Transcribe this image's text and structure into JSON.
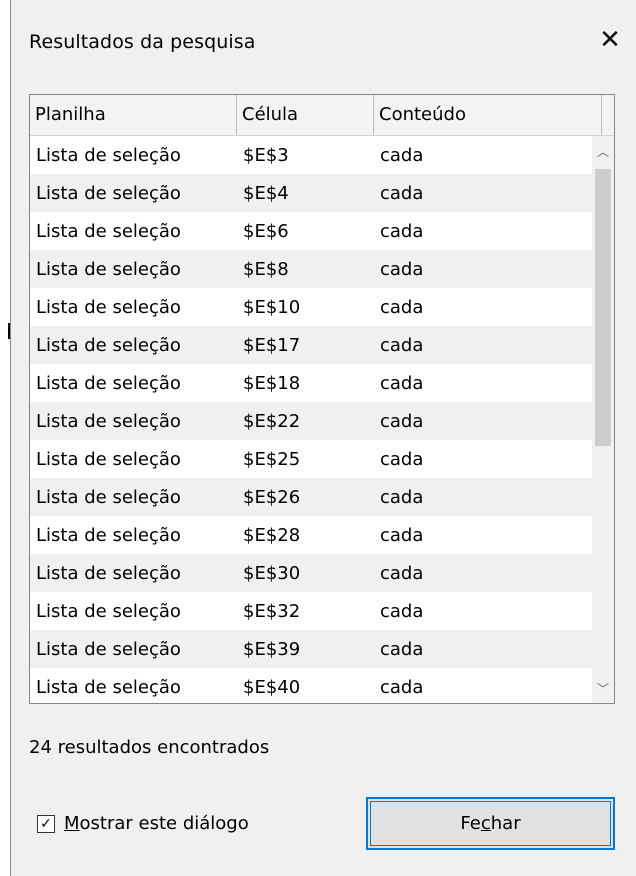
{
  "window": {
    "title": "Resultados da pesquisa",
    "close_glyph": "✕",
    "close_icon": "close-icon"
  },
  "table": {
    "columns": [
      "Planilha",
      "Célula",
      "Conteúdo"
    ],
    "rows": [
      [
        "Lista de seleção",
        "$E$3",
        "cada"
      ],
      [
        "Lista de seleção",
        "$E$4",
        "cada"
      ],
      [
        "Lista de seleção",
        "$E$6",
        "cada"
      ],
      [
        "Lista de seleção",
        "$E$8",
        "cada"
      ],
      [
        "Lista de seleção",
        "$E$10",
        "cada"
      ],
      [
        "Lista de seleção",
        "$E$17",
        "cada"
      ],
      [
        "Lista de seleção",
        "$E$18",
        "cada"
      ],
      [
        "Lista de seleção",
        "$E$22",
        "cada"
      ],
      [
        "Lista de seleção",
        "$E$25",
        "cada"
      ],
      [
        "Lista de seleção",
        "$E$26",
        "cada"
      ],
      [
        "Lista de seleção",
        "$E$28",
        "cada"
      ],
      [
        "Lista de seleção",
        "$E$30",
        "cada"
      ],
      [
        "Lista de seleção",
        "$E$32",
        "cada"
      ],
      [
        "Lista de seleção",
        "$E$39",
        "cada"
      ],
      [
        "Lista de seleção",
        "$E$40",
        "cada"
      ]
    ],
    "scroll_up_glyph": "︿",
    "scroll_down_glyph": "﹀"
  },
  "status": {
    "text": "24 resultados encontrados"
  },
  "options": {
    "show_dialog_mnemonic": "M",
    "show_dialog_rest": "ostrar este diálogo",
    "show_dialog_checked": true,
    "check_glyph": "✓"
  },
  "buttons": {
    "close_prefix": "Fe",
    "close_mnemonic": "c",
    "close_suffix": "har"
  },
  "colors": {
    "accent": "#0078d7",
    "dialog_bg": "#f0f0f0",
    "row_alt": "#f0f0f0"
  }
}
